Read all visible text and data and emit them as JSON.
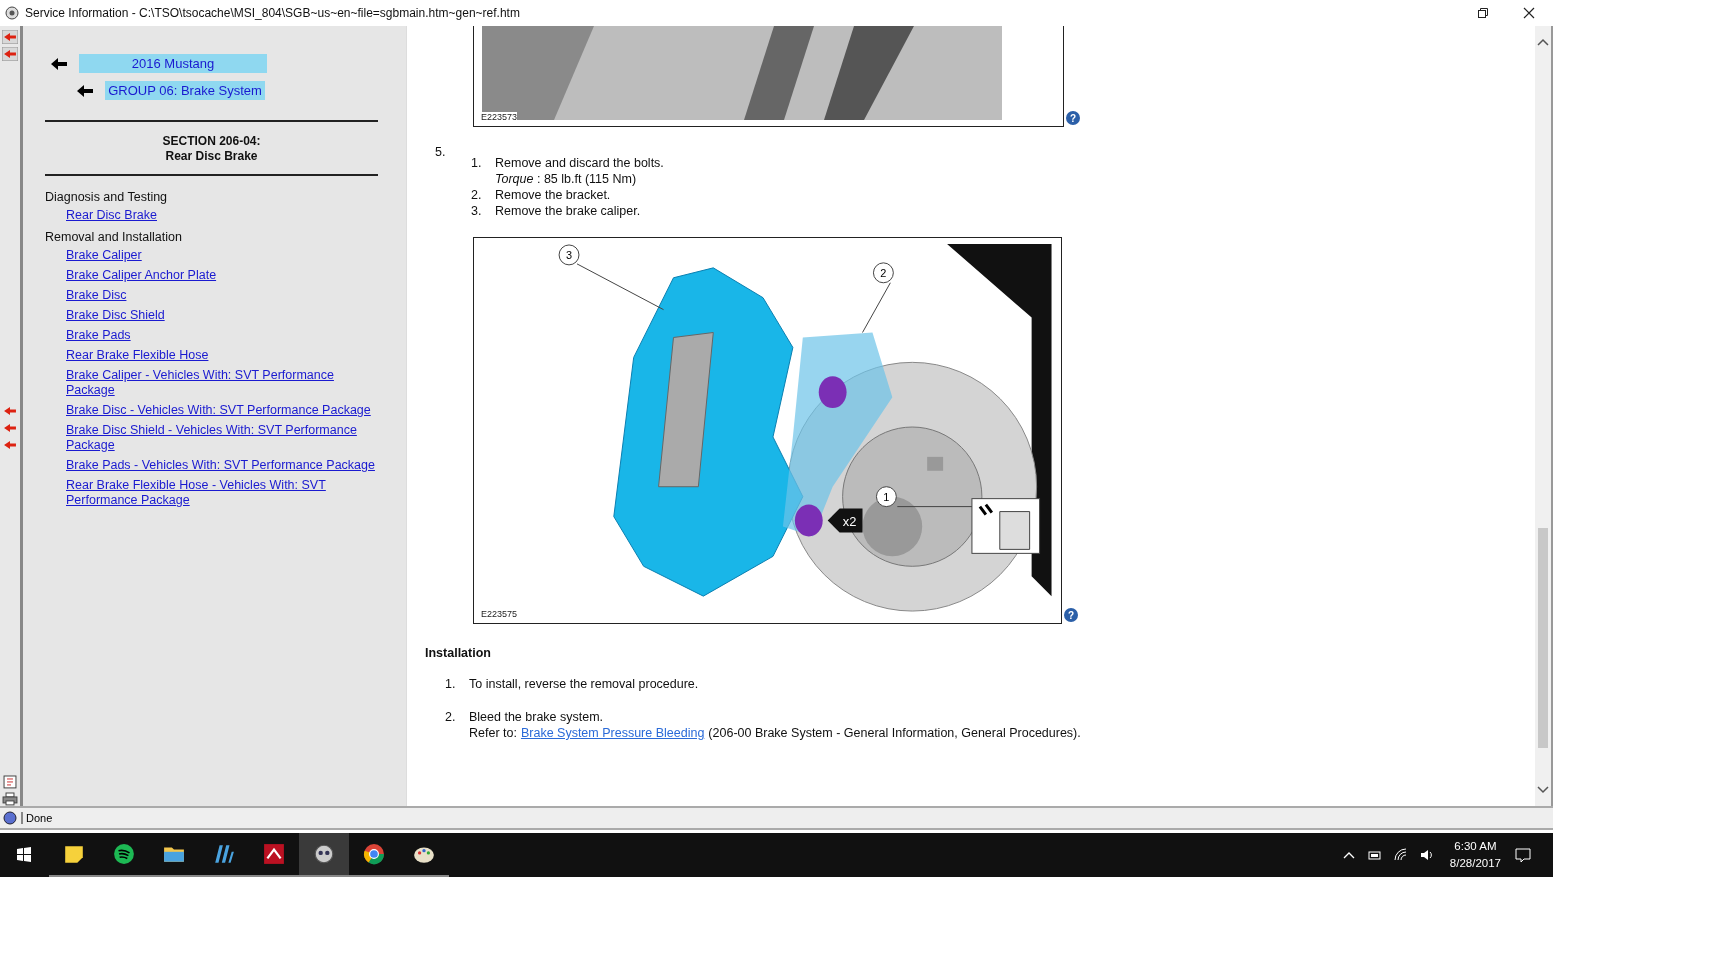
{
  "window": {
    "title": "Service Information - C:\\TSO\\tsocache\\MSI_804\\SGB~us~en~file=sgbmain.htm~gen~ref.htm"
  },
  "sidebar": {
    "breadcrumbs": [
      {
        "label": "2016 Mustang"
      },
      {
        "label": "GROUP 06: Brake System"
      }
    ],
    "section_code": "SECTION 206-04:",
    "section_title": "Rear Disc Brake",
    "groups": [
      {
        "heading": "Diagnosis and Testing",
        "links": [
          "Rear Disc Brake"
        ]
      },
      {
        "heading": "Removal and Installation",
        "links": [
          "Brake Caliper",
          "Brake Caliper Anchor Plate",
          "Brake Disc",
          "Brake Disc Shield",
          "Brake Pads",
          "Rear Brake Flexible Hose",
          "Brake Caliper - Vehicles With: SVT Performance Package",
          "Brake Disc - Vehicles With: SVT Performance Package",
          "Brake Disc Shield - Vehicles With: SVT Performance Package",
          "Brake Pads - Vehicles With: SVT Performance Package",
          "Rear Brake Flexible Hose - Vehicles With: SVT Performance Package"
        ]
      }
    ]
  },
  "top_figure": {
    "figure_id": "E223573",
    "help_glyph": "?"
  },
  "step": {
    "number": "5.",
    "substeps": [
      {
        "number": "1.",
        "text": "Remove and discard the bolts.",
        "note": "*Torque* : 85 lb.ft (115 Nm)"
      },
      {
        "number": "2.",
        "text": "Remove the bracket."
      },
      {
        "number": "3.",
        "text": "Remove the brake caliper."
      }
    ]
  },
  "figure": {
    "figure_id": "E223575",
    "help_glyph": "?",
    "callouts": [
      "3",
      "2",
      "1"
    ],
    "multiplier": "x2"
  },
  "installation": {
    "heading": "Installation",
    "steps": [
      {
        "number": "1.",
        "text": "To install, reverse the removal procedure."
      },
      {
        "number": "2.",
        "text": "Bleed the brake system.",
        "refer_prefix": "Refer to:",
        "link": "Brake System Pressure Bleeding",
        "refer_suffix": "(206-00 Brake System - General Information, General Procedures)."
      }
    ]
  },
  "status_bar": {
    "text": "Done"
  },
  "taskbar": {
    "apps": [
      {
        "kind": "notes",
        "selected": false
      },
      {
        "kind": "music",
        "selected": false
      },
      {
        "kind": "folder",
        "selected": false
      },
      {
        "kind": "bars",
        "selected": false
      },
      {
        "kind": "red",
        "selected": false
      },
      {
        "kind": "robot",
        "selected": true
      },
      {
        "kind": "browser",
        "selected": false
      },
      {
        "kind": "paint",
        "selected": false
      }
    ],
    "time": "6:30 AM",
    "date": "8/28/2017"
  }
}
